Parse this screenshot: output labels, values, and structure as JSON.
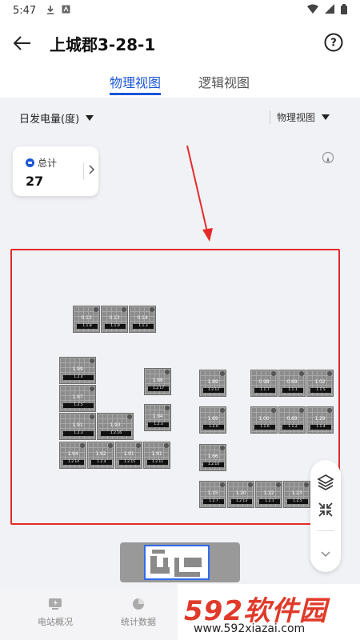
{
  "status_bar": {
    "time": "5:47"
  },
  "app_bar": {
    "title": "上城郡3-28-1"
  },
  "tabs": [
    {
      "label": "物理视图",
      "active": true
    },
    {
      "label": "逻辑视图",
      "active": false
    }
  ],
  "filters": {
    "metric_selected": "日发电量(度)",
    "view_selected": "物理视图"
  },
  "summary_card": {
    "label": "总计",
    "value": "27"
  },
  "panels": [
    {
      "value": "0.13",
      "id": "1.1.8"
    },
    {
      "value": "0.13",
      "id": "1.1.9"
    },
    {
      "value": "0.14",
      "id": "1.1.3"
    },
    {
      "value": "1.99",
      "id": "1.2.4"
    },
    {
      "value": "1.97",
      "id": "1.2.5"
    },
    {
      "value": "1.91",
      "id": "1.2.3"
    },
    {
      "value": "1.93",
      "id": "1.2.16"
    },
    {
      "value": "1.94",
      "id": "1.2.14"
    },
    {
      "value": "1.92",
      "id": "1.2.4"
    },
    {
      "value": "1.91",
      "id": "1.2.15"
    },
    {
      "value": "1.91",
      "id": "1.2.11"
    },
    {
      "value": "1.98",
      "id": "1.2.17"
    },
    {
      "value": "1.94",
      "id": "1.2.3"
    },
    {
      "value": "1.89",
      "id": "1.2.12"
    },
    {
      "value": "1.69",
      "id": "1.2.0"
    },
    {
      "value": "1.66",
      "id": "1.2.10"
    },
    {
      "value": "1.15",
      "id": "1.2.7"
    },
    {
      "value": "1.20",
      "id": "1.2.13"
    },
    {
      "value": "1.22",
      "id": "1.2.1"
    },
    {
      "value": "1.23",
      "id": "1.2.5"
    },
    {
      "value": "0.98",
      "id": "1.1.7"
    },
    {
      "value": "0.69",
      "id": "1.1.1"
    },
    {
      "value": "1.02",
      "id": "1.1.5"
    },
    {
      "value": "1.00",
      "id": "1.1.6"
    },
    {
      "value": "0.69",
      "id": "1.1.2"
    },
    {
      "value": "1.29",
      "id": "1.1.4"
    }
  ],
  "bottom_nav": [
    {
      "label": "电站概况",
      "icon": "station-icon"
    },
    {
      "label": "统计数据",
      "icon": "pie-chart-icon"
    }
  ],
  "watermark": {
    "brand": "592软件园",
    "url": "www.592xiazai.com"
  },
  "colors": {
    "accent": "#1a56d8",
    "highlight": "#e52b2b",
    "panel": "#8c8c8c"
  }
}
